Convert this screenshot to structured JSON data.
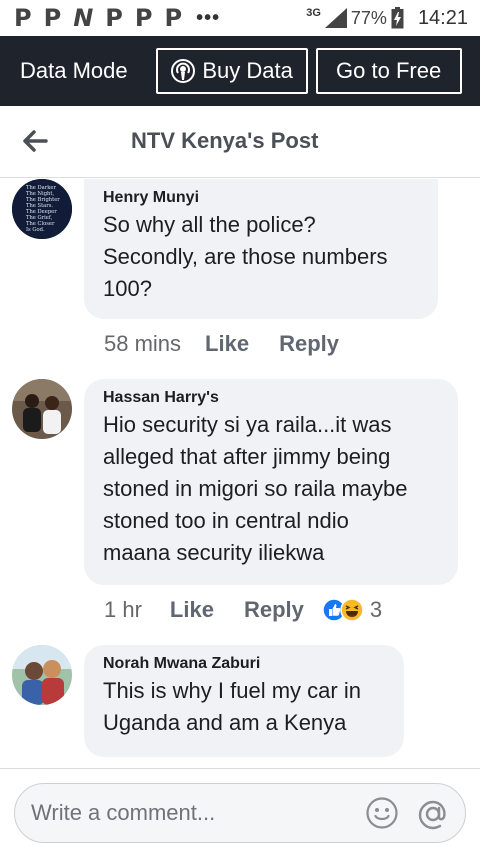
{
  "status_bar": {
    "notifications": [
      "P",
      "P",
      "N",
      "P",
      "P",
      "P"
    ],
    "overflow": "•••",
    "network": "3G",
    "battery_percent": "77%",
    "time": "14:21"
  },
  "data_bar": {
    "mode_label": "Data Mode",
    "buy_label": "Buy Data",
    "free_label": "Go to Free"
  },
  "header": {
    "title": "NTV Kenya's Post"
  },
  "comments": [
    {
      "author": "Henry Munyi",
      "lines": [
        "So why all the police?",
        "Secondly, are those numbers",
        "100?"
      ],
      "time": "58 mins",
      "like": "Like",
      "reply": "Reply",
      "avatar_text": [
        "The Darker",
        "The Night,",
        "The Brighter",
        "The Stars.",
        "The Deeper",
        "The Grief,",
        "The Closer",
        "Is God."
      ]
    },
    {
      "author": "Hassan Harry's",
      "lines": [
        "Hio security si ya raila...it was",
        "alleged that after jimmy being",
        "stoned in migori so raila maybe",
        "stoned too in central ndio",
        "maana security iliekwa"
      ],
      "time": "1 hr",
      "like": "Like",
      "reply": "Reply",
      "reaction_count": "3",
      "reactions": [
        "like-reaction",
        "haha-reaction"
      ]
    },
    {
      "author": "Norah Mwana Zaburi",
      "lines": [
        "This is why I fuel my car in",
        "Uganda and am a Kenya"
      ]
    }
  ],
  "composer": {
    "placeholder": "Write a comment..."
  },
  "colors": {
    "data_bar_bg": "#1f232b",
    "bubble_bg": "#f0f2f5",
    "like_blue": "#1877f2",
    "haha_yellow": "#f7b928"
  }
}
